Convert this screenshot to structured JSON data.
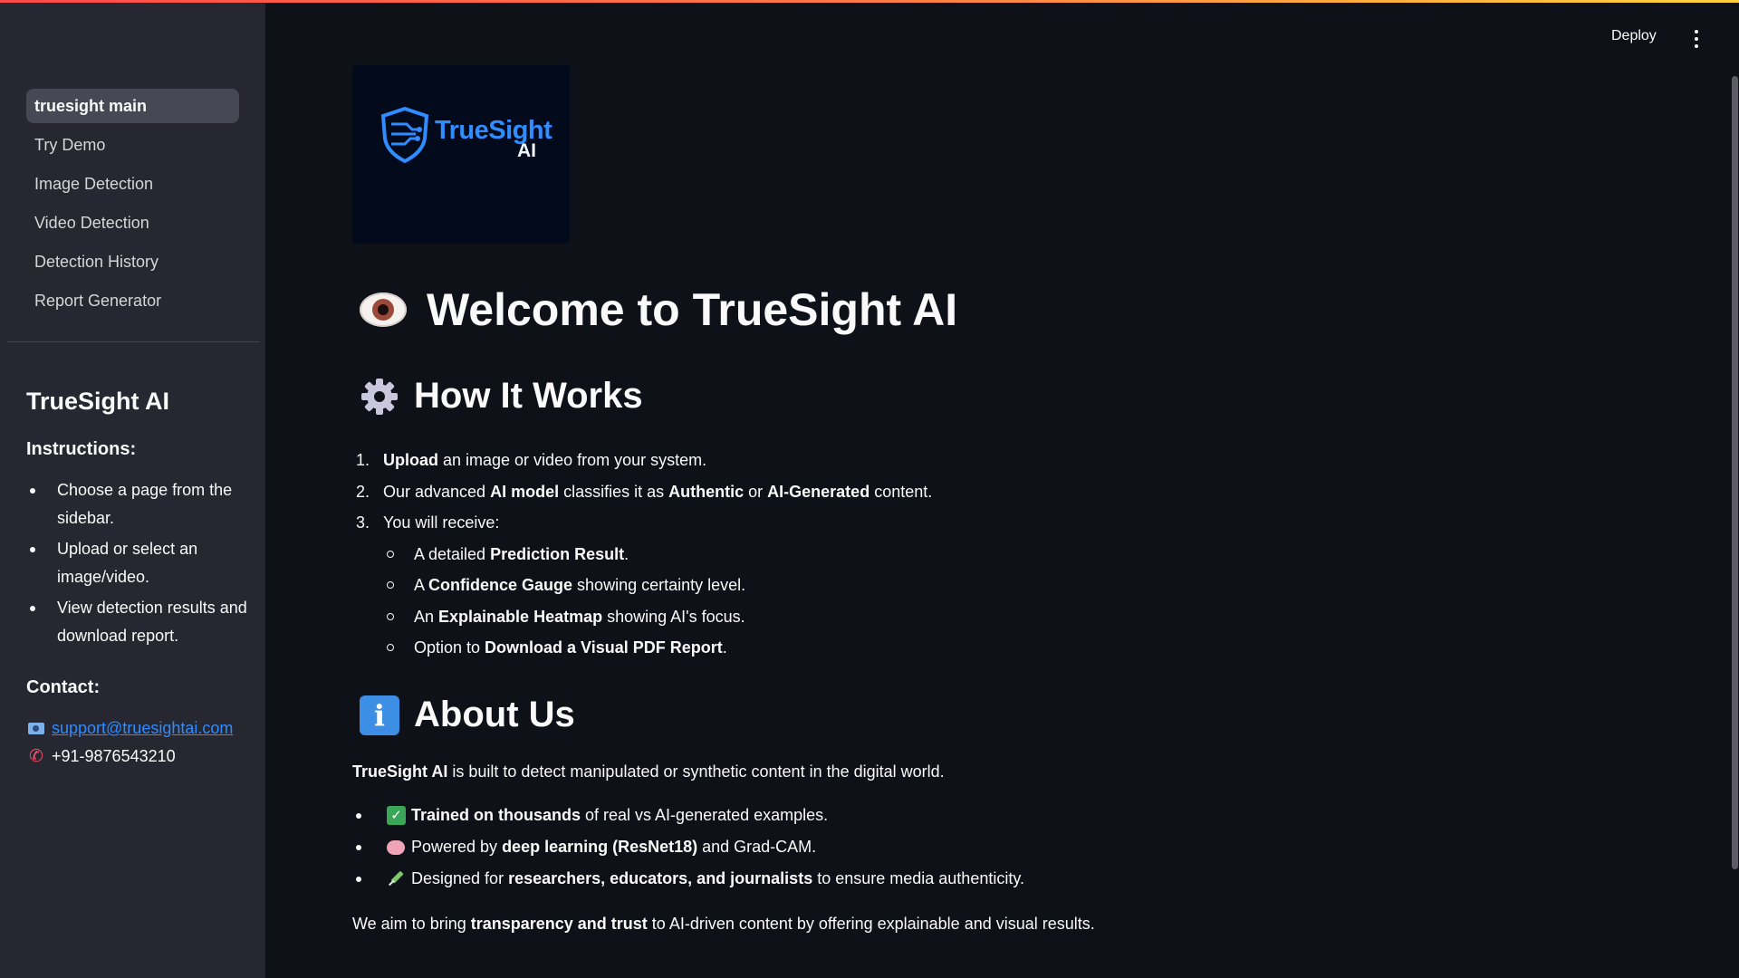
{
  "sidebar": {
    "nav": [
      {
        "label": "truesight main",
        "active": true
      },
      {
        "label": "Try Demo"
      },
      {
        "label": "Image Detection"
      },
      {
        "label": "Video Detection"
      },
      {
        "label": "Detection History"
      },
      {
        "label": "Report Generator"
      }
    ],
    "title": "TrueSight AI",
    "instructions_heading": "Instructions:",
    "instructions": [
      "Choose a page from the sidebar.",
      "Upload or select an image/video.",
      "View detection results and download report."
    ],
    "contact_heading": "Contact:",
    "email": "support@truesightai.com",
    "phone": "+91-9876543210"
  },
  "header": {
    "deploy_label": "Deploy"
  },
  "logo": {
    "name": "TrueSight",
    "suffix": "AI"
  },
  "main": {
    "title": "Welcome to TrueSight AI",
    "how_heading": "How It Works",
    "steps": [
      {
        "num": "1.",
        "parts": [
          [
            "Upload",
            true
          ],
          [
            " an image or video from your system.",
            false
          ]
        ]
      },
      {
        "num": "2.",
        "parts": [
          [
            "Our advanced ",
            false
          ],
          [
            "AI model",
            true
          ],
          [
            " classifies it as ",
            false
          ],
          [
            "Authentic",
            true
          ],
          [
            " or ",
            false
          ],
          [
            "AI-Generated",
            true
          ],
          [
            " content.",
            false
          ]
        ]
      },
      {
        "num": "3.",
        "parts": [
          [
            "You will receive:",
            false
          ]
        ]
      }
    ],
    "receive": [
      {
        "parts": [
          [
            "A detailed ",
            false
          ],
          [
            "Prediction Result",
            true
          ],
          [
            ".",
            false
          ]
        ]
      },
      {
        "parts": [
          [
            "A ",
            false
          ],
          [
            "Confidence Gauge",
            true
          ],
          [
            " showing certainty level.",
            false
          ]
        ]
      },
      {
        "parts": [
          [
            "An ",
            false
          ],
          [
            "Explainable Heatmap",
            true
          ],
          [
            " showing AI's focus.",
            false
          ]
        ]
      },
      {
        "parts": [
          [
            "Option to ",
            false
          ],
          [
            "Download a Visual PDF Report",
            true
          ],
          [
            ".",
            false
          ]
        ]
      }
    ],
    "about_heading": "About Us",
    "about_intro": [
      [
        "TrueSight AI",
        true
      ],
      [
        " is built to detect manipulated or synthetic content in the digital world.",
        false
      ]
    ],
    "about_points": [
      {
        "icon": "check-icon",
        "parts": [
          [
            "Trained on thousands",
            true
          ],
          [
            " of real vs AI-generated examples.",
            false
          ]
        ]
      },
      {
        "icon": "brain-icon",
        "parts": [
          [
            "Powered by ",
            false
          ],
          [
            "deep learning (ResNet18)",
            true
          ],
          [
            " and Grad-CAM.",
            false
          ]
        ]
      },
      {
        "icon": "syringe-icon",
        "parts": [
          [
            "Designed for ",
            false
          ],
          [
            "researchers, educators, and journalists",
            true
          ],
          [
            " to ensure media authenticity.",
            false
          ]
        ]
      }
    ],
    "closing": [
      [
        "We aim to bring ",
        false
      ],
      [
        "transparency and trust",
        true
      ],
      [
        " to AI-driven content by offering explainable and visual results.",
        false
      ]
    ]
  },
  "colors": {
    "background": "#0e1117",
    "sidebar": "#262730",
    "link": "#2f8cff",
    "logo_accent": "#2f8dff"
  }
}
